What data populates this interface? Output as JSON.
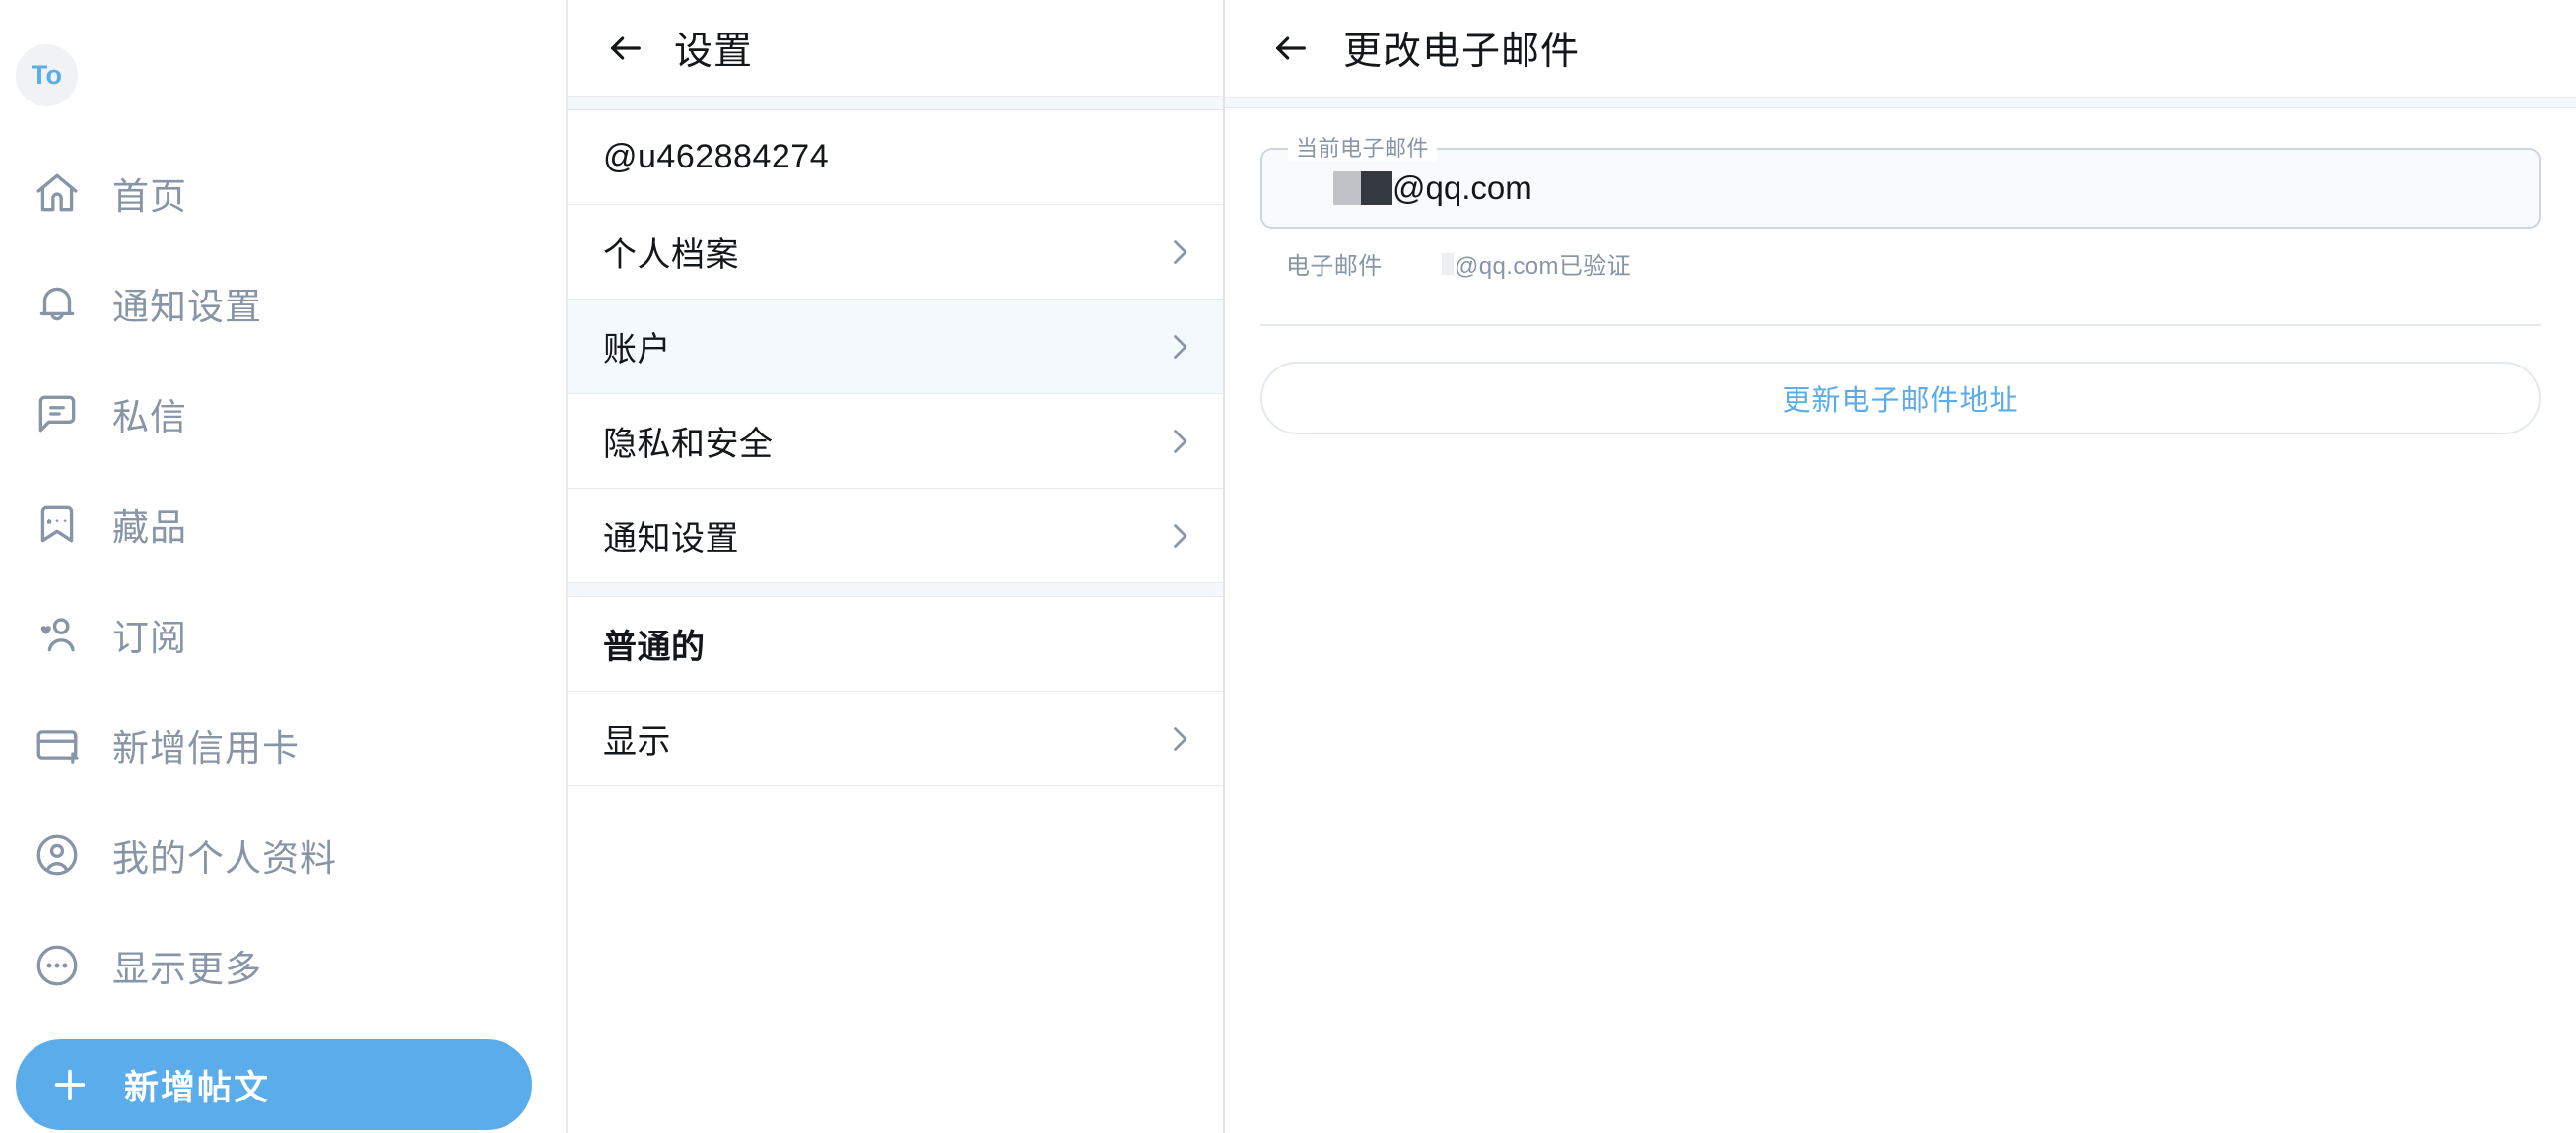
{
  "sidebar": {
    "avatar_text": "To",
    "items": [
      {
        "label": "首页",
        "icon": "home-icon"
      },
      {
        "label": "通知设置",
        "icon": "bell-icon"
      },
      {
        "label": "私信",
        "icon": "message-icon"
      },
      {
        "label": "藏品",
        "icon": "bookmark-stars-icon"
      },
      {
        "label": "订阅",
        "icon": "subscriptions-person-heart-icon"
      },
      {
        "label": "新增信用卡",
        "icon": "credit-card-plus-icon"
      },
      {
        "label": "我的个人资料",
        "icon": "profile-circle-icon"
      },
      {
        "label": "显示更多",
        "icon": "more-dots-circle-icon"
      }
    ],
    "compose_label": "新增帖文"
  },
  "settings": {
    "header_title": "设置",
    "rows": [
      {
        "label": "@u462884274",
        "chevron": false,
        "selected": false,
        "section": false
      },
      {
        "label": "个人档案",
        "chevron": true,
        "selected": false,
        "section": false
      },
      {
        "label": "账户",
        "chevron": true,
        "selected": true,
        "section": false
      },
      {
        "label": "隐私和安全",
        "chevron": true,
        "selected": false,
        "section": false
      },
      {
        "label": "通知设置",
        "chevron": true,
        "selected": false,
        "section": false
      }
    ],
    "group_header": "普通的",
    "rows_after": [
      {
        "label": "显示",
        "chevron": true,
        "selected": false,
        "section": false
      }
    ]
  },
  "detail": {
    "header_title": "更改电子邮件",
    "field_label": "当前电子邮件",
    "field_value_suffix": "@qq.com",
    "helper_label": "电子邮件",
    "helper_value": "@qq.com已验证",
    "update_button_label": "更新电子邮件地址"
  },
  "colors": {
    "accent": "#5aaceb",
    "muted": "#8895a7",
    "selected_row": "#f3f9fd",
    "band": "#f5f8fa",
    "border": "#e6eaee"
  }
}
